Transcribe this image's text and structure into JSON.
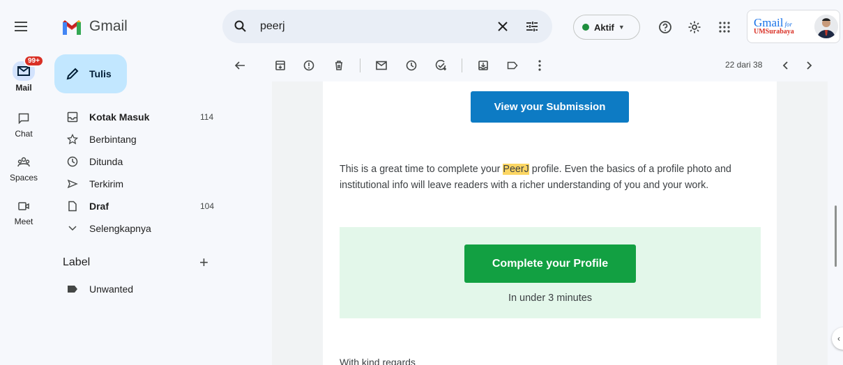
{
  "app": {
    "name": "Gmail"
  },
  "rail": {
    "mail": {
      "label": "Mail",
      "badge": "99+"
    },
    "chat": {
      "label": "Chat"
    },
    "spaces": {
      "label": "Spaces"
    },
    "meet": {
      "label": "Meet"
    }
  },
  "compose": {
    "label": "Tulis"
  },
  "nav": {
    "items": [
      {
        "label": "Kotak Masuk",
        "count": "114",
        "icon": "inbox-icon"
      },
      {
        "label": "Berbintang",
        "count": "",
        "icon": "star-icon"
      },
      {
        "label": "Ditunda",
        "count": "",
        "icon": "clock-icon"
      },
      {
        "label": "Terkirim",
        "count": "",
        "icon": "send-icon"
      },
      {
        "label": "Draf",
        "count": "104",
        "icon": "draft-icon"
      },
      {
        "label": "Selengkapnya",
        "count": "",
        "icon": "chevron-down-icon"
      }
    ],
    "labels_heading": "Label",
    "labels": [
      {
        "label": "Unwanted"
      }
    ]
  },
  "search": {
    "value": "peerj"
  },
  "status": {
    "label": "Aktif"
  },
  "account": {
    "logo_main": "Gmail",
    "logo_for": "for",
    "logo_sub": "UMSurabaya"
  },
  "toolbar": {
    "pager": "22 dari 38"
  },
  "message": {
    "view_button": "View your Submission",
    "body_before": "This is a great time to complete your ",
    "body_highlight": "PeerJ",
    "body_after": " profile. Even the basics of a profile photo and institutional info will leave readers with a richer understanding of you and your work.",
    "profile_button": "Complete your Profile",
    "profile_sub": "In under 3 minutes",
    "regards": "With kind regards"
  },
  "colors": {
    "compose": "#c2e7ff",
    "view_button": "#0d7bc4",
    "profile_button": "#12a042",
    "cta_bg": "#e3f7ea",
    "highlight": "#fcd663"
  }
}
